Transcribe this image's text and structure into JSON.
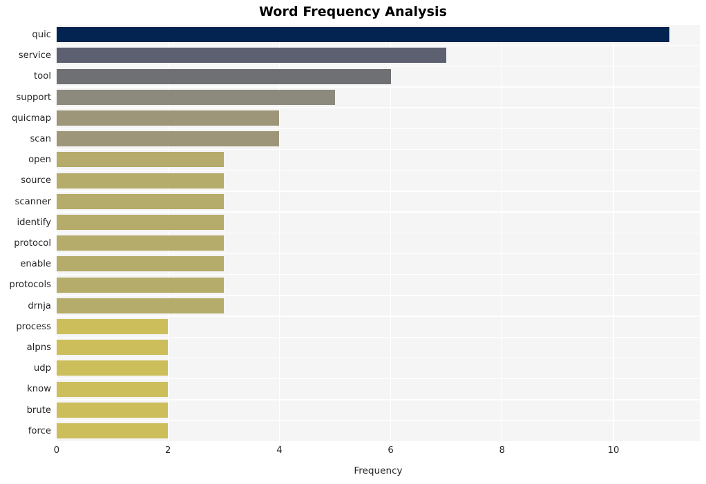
{
  "chart_data": {
    "type": "bar",
    "orientation": "horizontal",
    "title": "Word Frequency Analysis",
    "xlabel": "Frequency",
    "ylabel": "",
    "categories": [
      "quic",
      "service",
      "tool",
      "support",
      "quicmap",
      "scan",
      "open",
      "source",
      "scanner",
      "identify",
      "protocol",
      "enable",
      "protocols",
      "drnja",
      "process",
      "alpns",
      "udp",
      "know",
      "brute",
      "force"
    ],
    "values": [
      11,
      7,
      6,
      5,
      4,
      4,
      3,
      3,
      3,
      3,
      3,
      3,
      3,
      3,
      2,
      2,
      2,
      2,
      2,
      2
    ],
    "xticks": [
      "0",
      "2",
      "4",
      "6",
      "8",
      "10"
    ],
    "xtick_values": [
      0,
      2,
      4,
      6,
      8,
      10
    ],
    "xlim": [
      0,
      11.55
    ],
    "grid": "vertical-white-on-gray",
    "legend": "none",
    "bar_colors": [
      "#032450",
      "#5c6070",
      "#6e7074",
      "#8b8a7c",
      "#9d9678",
      "#9d9678",
      "#b5ab6a",
      "#b5ab6a",
      "#b5ab6a",
      "#b5ab6a",
      "#b5ab6a",
      "#b5ab6a",
      "#b5ab6a",
      "#b5ab6a",
      "#cdbe5c",
      "#cdbe5c",
      "#cdbe5c",
      "#cdbe5c",
      "#cdbe5c",
      "#cdbe5c"
    ],
    "plot_background": "#f5f5f6",
    "gridline_color": "#ffffff",
    "figure_background": "#ffffff"
  }
}
